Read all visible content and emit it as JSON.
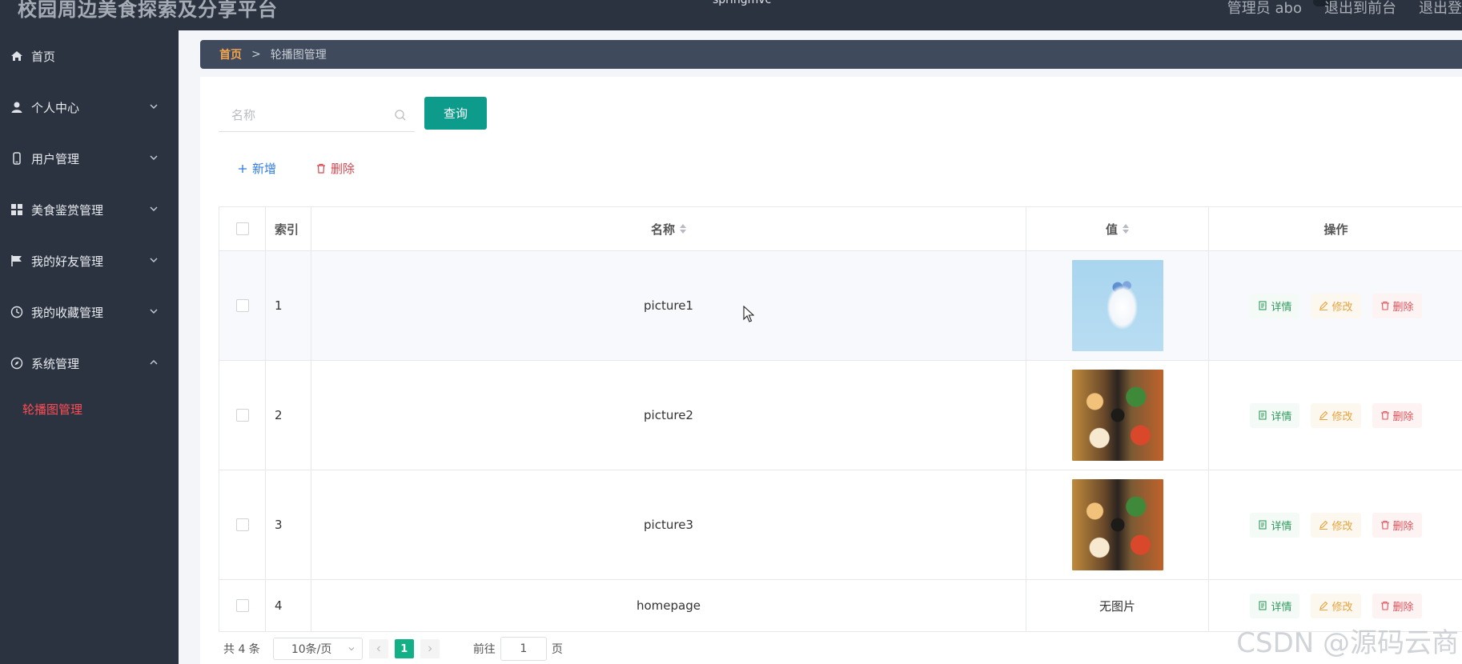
{
  "topbar": {
    "app_title": "校园周边美食探索及分享平台",
    "center_text": "springmvc",
    "user_label": "管理员 abo",
    "to_front_label": "退出到前台",
    "logout_label": "退出登"
  },
  "sidebar": {
    "items": [
      {
        "label": "首页",
        "icon": "home-icon"
      },
      {
        "label": "个人中心",
        "icon": "user-icon"
      },
      {
        "label": "用户管理",
        "icon": "phone-icon"
      },
      {
        "label": "美食鉴赏管理",
        "icon": "grid-icon"
      },
      {
        "label": "我的好友管理",
        "icon": "flag-icon"
      },
      {
        "label": "我的收藏管理",
        "icon": "clock-icon"
      },
      {
        "label": "系统管理",
        "icon": "compass-icon"
      }
    ],
    "sub_active": "轮播图管理"
  },
  "breadcrumb": {
    "home": "首页",
    "sep": ">",
    "current": "轮播图管理"
  },
  "search": {
    "placeholder": "名称",
    "query_label": "查询"
  },
  "actions": {
    "add_label": "新增",
    "delete_label": "删除"
  },
  "table": {
    "headers": {
      "index": "索引",
      "name": "名称",
      "value": "值",
      "ops": "操作"
    },
    "rows": [
      {
        "index": "1",
        "name": "picture1",
        "image": "cake"
      },
      {
        "index": "2",
        "name": "picture2",
        "image": "food"
      },
      {
        "index": "3",
        "name": "picture3",
        "image": "food"
      },
      {
        "index": "4",
        "name": "homepage",
        "value_text": "无图片"
      }
    ],
    "op_labels": {
      "detail": "详情",
      "edit": "修改",
      "delete": "删除"
    }
  },
  "pagination": {
    "total": "共 4 条",
    "page_size": "10条/页",
    "current_page": "1",
    "goto_label": "前往",
    "goto_value": "1",
    "page_suffix": "页"
  },
  "watermark": "CSDN @源码云商",
  "colors": {
    "sidebar_bg": "#2b3340",
    "primary": "#0d9c8c",
    "active_menu": "#ff4d56"
  }
}
